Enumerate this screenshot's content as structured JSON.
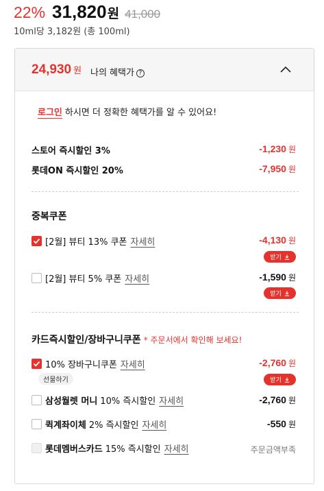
{
  "product": {
    "discount_rate": "22%",
    "final_price": "31,820",
    "won": "원",
    "original_price": "41,000",
    "unit_price": "10ml당 3,182원 (총 100ml)"
  },
  "benefit": {
    "price": "24,930",
    "won": "원",
    "label": "나의 혜택가",
    "help_symbol": "?"
  },
  "login_notice": {
    "link": "로그인",
    "text": "하시면 더 정확한 혜택가를 알 수 있어요!"
  },
  "instant_discounts": [
    {
      "label": "스토어 즉시할인 3%",
      "amount": "-1,230",
      "won": "원"
    },
    {
      "label": "롯데ON 즉시할인 20%",
      "amount": "-7,950",
      "won": "원"
    }
  ],
  "duplicate_coupons": {
    "title": "중복쿠폰",
    "items": [
      {
        "label": "[2월] 뷰티 13% 쿠폰",
        "detail": "자세히",
        "amount": "-4,130",
        "won": "원",
        "checked": true,
        "button": "받기"
      },
      {
        "label": "[2월] 뷰티 5% 쿠폰",
        "detail": "자세히",
        "amount": "-1,590",
        "won": "원",
        "checked": false,
        "button": "받기"
      }
    ]
  },
  "card_coupons": {
    "title": "카드즉시할인/장바구니쿠폰",
    "note": "* 주문서에서 확인해 보세요!",
    "items": [
      {
        "label": "10% 장바구니쿠폰",
        "detail": "자세히",
        "amount": "-2,760",
        "won": "원",
        "checked": true,
        "button": "받기",
        "gift": "선물하기"
      },
      {
        "label": "삼성월렛 머니",
        "label_rest": "10% 즉시할인",
        "detail": "자세히",
        "amount": "-2,760",
        "won": "원",
        "checked": false
      },
      {
        "label": "퀵계좌이체",
        "label_rest": "2% 즉시할인",
        "detail": "자세히",
        "amount": "-550",
        "won": "원",
        "checked": false
      },
      {
        "label": "롯데멤버스카드",
        "label_rest": "15% 즉시할인",
        "detail": "자세히",
        "status": "주문금액부족",
        "checked": false,
        "disabled": true
      }
    ]
  },
  "colors": {
    "accent": "#e5322d",
    "panel_header": "#f6f6f6"
  },
  "icons": {
    "collapse": "chevron-up-icon",
    "download": "download-icon",
    "check": "check-icon"
  }
}
